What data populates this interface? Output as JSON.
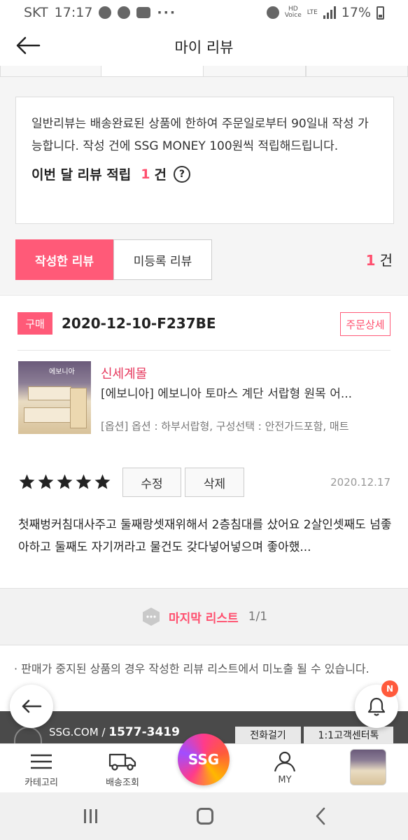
{
  "status_bar": {
    "carrier": "SKT",
    "time": "17:17",
    "dots": "···",
    "hd_label": "HD",
    "voice_label": "Voice",
    "lte_label": "LTE",
    "battery": "17%"
  },
  "header": {
    "title": "마이 리뷰"
  },
  "notice": {
    "text": "일반리뷰는 배송완료된 상품에 한하여 주문일로부터 90일내 작성 가능합니다. 작성 건에 SSG MONEY 100원씩 적립해드립니다.",
    "count_label": "이번 달 리뷰 적립",
    "count_value": "1",
    "count_unit": "건",
    "help_icon": "?"
  },
  "review_tabs": {
    "written": "작성한 리뷰",
    "unregistered": "미등록 리뷰"
  },
  "total": {
    "value": "1",
    "unit": "건"
  },
  "review": {
    "badge": "구매",
    "order_no": "2020-12-10-F237BE",
    "order_detail": "주문상세",
    "thumb_label": "에보니아",
    "brand": "신세계몰",
    "product_name": "[에보니아] 에보니아 토마스 계단 서랍형 원목 어...",
    "option": "[옵션] 옵션 : 하부서랍형, 구성선택 : 안전가드포함, 매트",
    "rating": 5,
    "edit": "수정",
    "delete": "삭제",
    "date": "2020.12.17",
    "text": "첫째벙커침대사주고 둘째랑셋재위해서 2층침대를 샀어요 2살인셋째도 넘좋아하고 둘째도 자기꺼라고 물건도 갖다넣어넣으며 좋아했..."
  },
  "last_list": {
    "label": "마지막 리스트",
    "pages": "1/1"
  },
  "footnote": "· 판매가 중지된 상품의 경우 작성한 리뷰 리스트에서 미노출 될 수 있습니다.",
  "bell_badge": "N",
  "footer": {
    "site": "SSG.COM /",
    "phone": "1577-3419",
    "call": "전화걸기",
    "center": "1:1고객센터톡"
  },
  "bottom_nav": {
    "category": "카테고리",
    "delivery": "배송조회",
    "ssg": "SSG",
    "my": "MY"
  },
  "colors": {
    "accent": "#ff5a78",
    "brand_text": "#e6375c",
    "footer_bg": "#4a4a4a"
  },
  "icons": [
    "back-arrow-icon",
    "help-icon",
    "star-icon",
    "hexagon-icon",
    "bell-icon",
    "menu-icon",
    "truck-icon",
    "person-icon"
  ]
}
